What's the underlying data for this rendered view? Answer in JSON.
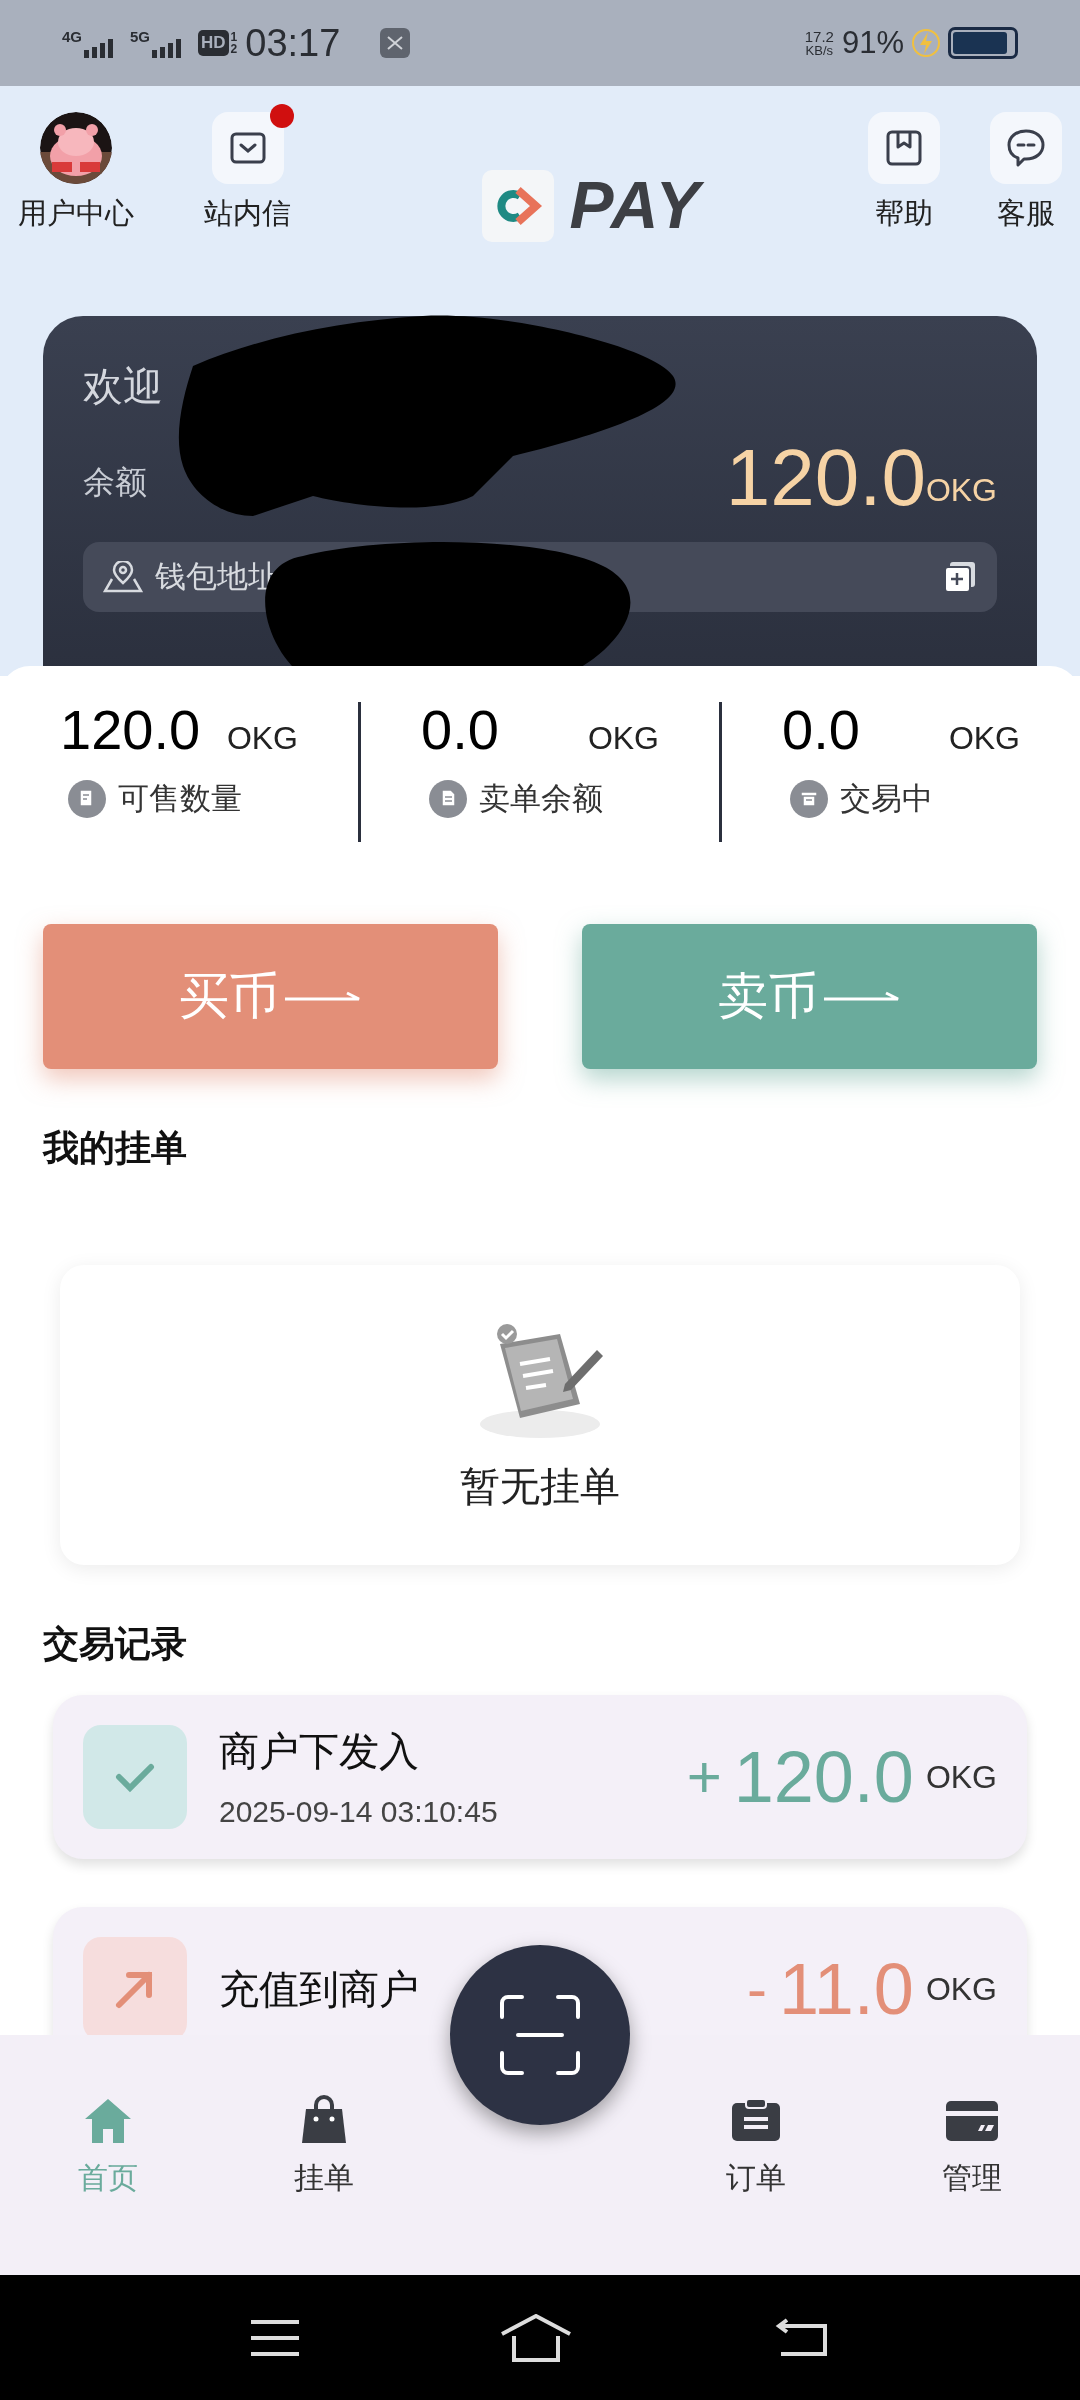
{
  "status_bar": {
    "network_1": "4G",
    "network_2": "5G",
    "hd": "HD",
    "hd_slots": [
      "1",
      "2"
    ],
    "time": "03:17",
    "speed": "17.2",
    "speed_unit": "KB/s",
    "battery": "91%"
  },
  "header": {
    "left_items": [
      {
        "label": "用户中心",
        "kind": "avatar"
      },
      {
        "label": "站内信",
        "kind": "mail",
        "unread": true
      }
    ],
    "logo": "PAY",
    "right_items": [
      {
        "label": "帮助",
        "kind": "help"
      },
      {
        "label": "客服",
        "kind": "chat"
      }
    ]
  },
  "account_card": {
    "greeting": "欢迎",
    "balance_label": "余额",
    "balance": "120.0",
    "balance_unit": "OKG",
    "wallet_label": "钱包地址"
  },
  "stats": [
    {
      "value": "120.0",
      "unit": "OKG",
      "label": "可售数量",
      "kind": "sale"
    },
    {
      "value": "0.0",
      "unit": "OKG",
      "label": "卖单余额",
      "kind": "doc"
    },
    {
      "value": "0.0",
      "unit": "OKG",
      "label": "交易中",
      "kind": "trade"
    }
  ],
  "actions": [
    {
      "label": "买币",
      "kind": "buy"
    },
    {
      "label": "卖币",
      "kind": "sell"
    }
  ],
  "my_orders": {
    "title": "我的挂单",
    "empty_text": "暂无挂单"
  },
  "records": {
    "title": "交易记录",
    "items": [
      {
        "kind": "in",
        "title": "商户下发入",
        "time": "2025-09-14 03:10:45",
        "sign": "+",
        "amount": "120.0",
        "unit": "OKG"
      },
      {
        "kind": "out",
        "title": "充值到商户",
        "sign": "-",
        "amount": "11.0",
        "unit": "OKG"
      }
    ]
  },
  "tab_bar": [
    {
      "label": "首页",
      "kind": "home",
      "selected": true
    },
    {
      "label": "挂单",
      "kind": "bag",
      "selected": false
    },
    {
      "label": "订单",
      "kind": "orders",
      "selected": false
    },
    {
      "label": "管理",
      "kind": "card",
      "selected": false
    }
  ]
}
